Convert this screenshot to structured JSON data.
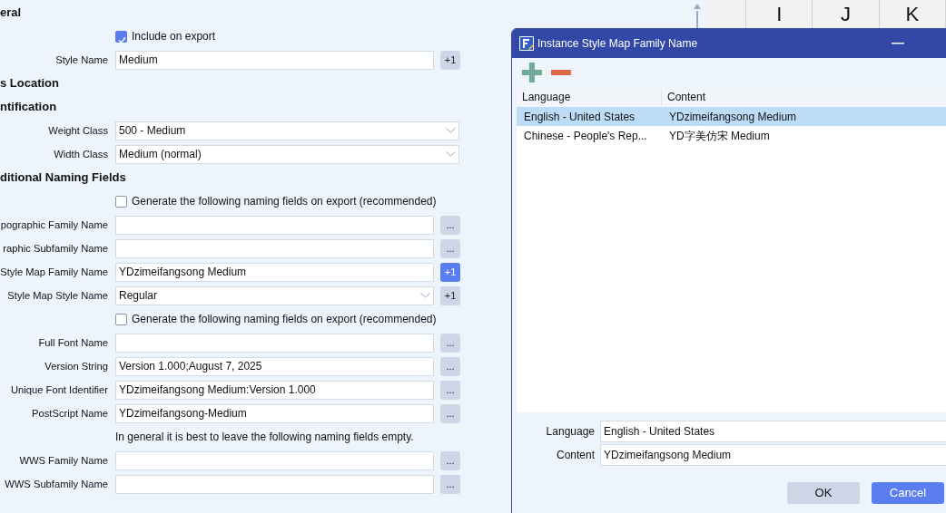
{
  "properties_panel": {
    "rows": [
      {
        "kind": "heading",
        "text": "eral"
      },
      {
        "kind": "checkbox",
        "label": "Include on export",
        "checked": true
      },
      {
        "kind": "text",
        "label": "Style Name",
        "value": "Medium",
        "button": "+1",
        "button_active": false
      },
      {
        "kind": "heading",
        "text": "s Location"
      },
      {
        "kind": "heading",
        "text": "ntification"
      },
      {
        "kind": "select",
        "label": "Weight Class",
        "value": "500 - Medium"
      },
      {
        "kind": "select",
        "label": "Width Class",
        "value": "Medium (normal)"
      },
      {
        "kind": "heading",
        "text": "ditional Naming Fields"
      },
      {
        "kind": "checkbox",
        "label": "Generate the following naming fields on export (recommended)",
        "checked": false
      },
      {
        "kind": "text",
        "label": "pographic Family Name",
        "value": "",
        "button": "...",
        "button_active": false
      },
      {
        "kind": "text",
        "label": "raphic Subfamily Name",
        "value": "",
        "button": "...",
        "button_active": false
      },
      {
        "kind": "text",
        "label": "Style Map Family Name",
        "value": "YDzimeifangsong Medium",
        "button": "+1",
        "button_active": true
      },
      {
        "kind": "select",
        "label": "Style Map Style Name",
        "value": "Regular",
        "button": "+1",
        "button_active": false
      },
      {
        "kind": "checkbox",
        "label": "Generate the following naming fields on export (recommended)",
        "checked": false
      },
      {
        "kind": "text",
        "label": "Full Font Name",
        "value": "",
        "button": "...",
        "button_active": false
      },
      {
        "kind": "text",
        "label": "Version String",
        "value": "Version 1.000;August 7, 2025",
        "button": "...",
        "button_active": false
      },
      {
        "kind": "text",
        "label": "Unique Font Identifier",
        "value": "YDzimeifangsong Medium:Version 1.000",
        "button": "...",
        "button_active": false
      },
      {
        "kind": "text",
        "label": "PostScript Name",
        "value": "YDzimeifangsong-Medium",
        "button": "...",
        "button_active": false
      },
      {
        "kind": "note",
        "text": "In general it is best to leave the following naming fields empty."
      },
      {
        "kind": "text",
        "label": "WWS Family Name",
        "value": "",
        "button": "...",
        "button_active": false
      },
      {
        "kind": "text",
        "label": "WWS Subfamily Name",
        "value": "",
        "button": "...",
        "button_active": false
      }
    ]
  },
  "glyph_grid": {
    "glyphs": [
      "I",
      "J",
      "K"
    ]
  },
  "dialog": {
    "title": "Instance Style Map Family Name",
    "table": {
      "columns": [
        "Language",
        "Content"
      ],
      "rows": [
        {
          "language": "English - United States",
          "content": "YDzimeifangsong Medium",
          "selected": true
        },
        {
          "language": "Chinese - People's Rep...",
          "content": "YD字美仿宋 Medium",
          "selected": false
        }
      ]
    },
    "form": [
      {
        "label": "Language",
        "value": "English - United States"
      },
      {
        "label": "Content",
        "value": "YDzimeifangsong Medium"
      }
    ],
    "buttons": [
      {
        "label": "OK",
        "primary": false
      },
      {
        "label": "Cancel",
        "primary": true
      }
    ]
  }
}
